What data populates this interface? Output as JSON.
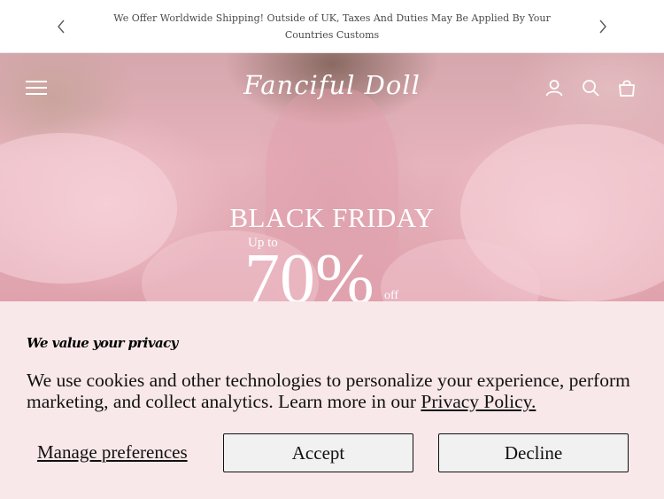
{
  "announcement": {
    "message": "We Offer Worldwide Shipping! Outside of UK, Taxes And Duties May Be Applied By Your Countries Customs",
    "prev_icon": "chevron-left-icon",
    "next_icon": "chevron-right-icon"
  },
  "header": {
    "logo_text": "Fanciful Doll",
    "menu_icon": "hamburger-menu-icon",
    "account_icon": "user-icon",
    "search_icon": "search-icon",
    "cart_icon": "shopping-bag-icon"
  },
  "hero": {
    "title": "BLACK FRIDAY",
    "up_to": "Up to",
    "percent": "70%",
    "off": "off"
  },
  "cookie_banner": {
    "title": "We value your privacy",
    "body": "We use cookies and other technologies to personalize your experience, perform marketing, and collect analytics. Learn more in our ",
    "link_text": "Privacy Policy.",
    "manage_label": "Manage preferences",
    "accept_label": "Accept",
    "decline_label": "Decline"
  },
  "colors": {
    "banner_bg": "#f9e8e9",
    "hero_pink": "#e7b3bc",
    "text_dark": "#111111"
  }
}
